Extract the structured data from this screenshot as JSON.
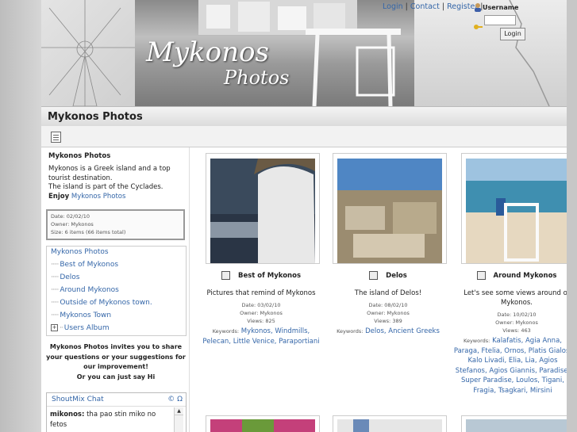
{
  "header": {
    "title_line1": "Mykonos",
    "title_line2": "Photos",
    "links": [
      "Login",
      "Contact",
      "Register"
    ],
    "username_label": "Username",
    "login_button": "Login"
  },
  "page_title": "Mykonos Photos",
  "left": {
    "album_title": "Mykonos Photos",
    "desc_line1": "Mykonos is a Greek island and a top tourist destination.",
    "desc_line2": "The island is part of the Cyclades.",
    "enjoy_label": "Enjoy",
    "enjoy_link": "Mykonos Photos",
    "info_date": "Date: 02/02/10",
    "info_owner": "Owner: Mykonos",
    "info_size": "Size: 6 items (66 items total)",
    "tree_root": "Mykonos Photos",
    "tree_items": [
      "Best of Mykonos",
      "Delos",
      "Around Mykonos",
      "Outside of Mykonos town.",
      "Mykonos Town",
      "Users Album"
    ],
    "invite": "Mykonos Photos invites you to share your questions or your suggestions for our improvement!",
    "invite_2": "Or you can just say Hi",
    "shout_title": "ShoutMix Chat",
    "shout_user": "mikonos:",
    "shout_text": "tha pao stin miko no fetos"
  },
  "albums": [
    {
      "title": "Best of Mykonos",
      "desc": "Pictures that remind of Mykonos",
      "date": "Date: 03/02/10",
      "owner": "Owner: Mykonos",
      "views": "Views: 825",
      "keywords_label": "Keywords:",
      "keywords": "Mykonos, Windmills, Pelecan, Little Venice, Paraportiani"
    },
    {
      "title": "Delos",
      "desc": "The island of Delos!",
      "date": "Date: 08/02/10",
      "owner": "Owner: Mykonos",
      "views": "Views: 389",
      "keywords_label": "Keywords:",
      "keywords": "Delos, Ancient Greeks"
    },
    {
      "title": "Around Mykonos",
      "desc": "Let's see some views around of Mykonos.",
      "date": "Date: 10/02/10",
      "owner": "Owner: Mykonos",
      "views": "Views: 463",
      "keywords_label": "Keywords:",
      "keywords": "Kalafatis, Agia Anna, Paraga, Ftelia, Ornos, Platis Gialos, Kalo Livadi, Elia, Lia, Agios Stefanos, Agios Giannis, Paradise, Super Paradise, Loulos, Tigani, Fragia, Tsagkari, Mirsini"
    }
  ]
}
